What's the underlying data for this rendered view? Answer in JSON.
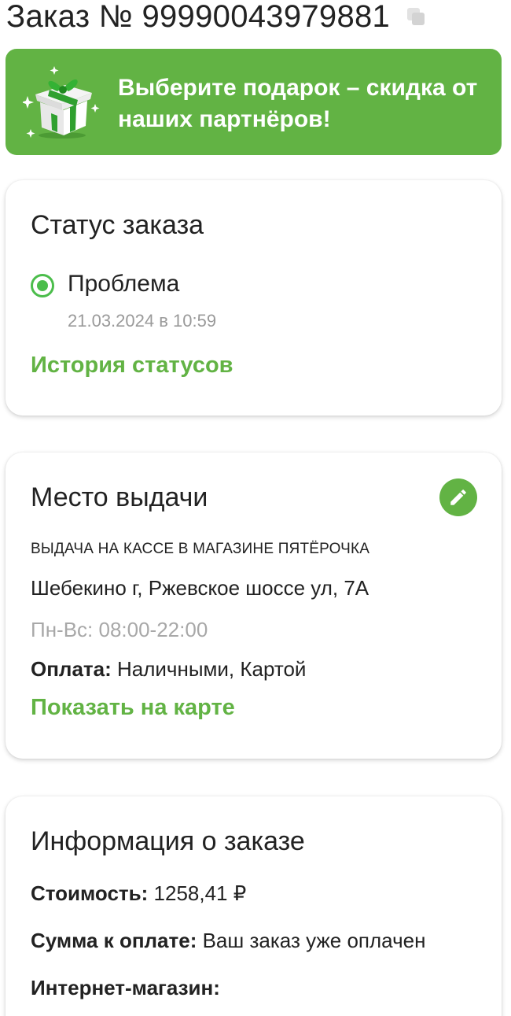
{
  "header": {
    "order_title": "Заказ № 99990043979881",
    "copy_icon": "copy-icon"
  },
  "banner": {
    "text": "Выберите подарок – скидка от наших партнёров!",
    "icon": "gift-box-icon",
    "bg_color": "#62b344"
  },
  "status_card": {
    "title": "Статус заказа",
    "status": "Проблема",
    "date": "21.03.2024 в 10:59",
    "history_link": "История статусов"
  },
  "pickup_card": {
    "title": "Место выдачи",
    "edit_icon": "pencil-icon",
    "type": "ВЫДАЧА НА КАССЕ В МАГАЗИНЕ ПЯТЁРОЧКА",
    "address": "Шебекино г, Ржевское шоссе ул, 7А",
    "hours": "Пн-Вс: 08:00-22:00",
    "payment_label": "Оплата:",
    "payment_value": " Наличными, Картой",
    "map_link": "Показать на карте"
  },
  "info_card": {
    "title": "Информация о заказе",
    "cost_label": "Стоимость:",
    "cost_value": " 1258,41 ₽",
    "due_label": "Сумма к оплате:",
    "due_value": " Ваш заказ уже оплачен",
    "shop_label": "Интернет-магазин:"
  },
  "colors": {
    "accent": "#62b344",
    "status_dot": "#4bbd4b",
    "muted_text": "#9a9a9a"
  }
}
